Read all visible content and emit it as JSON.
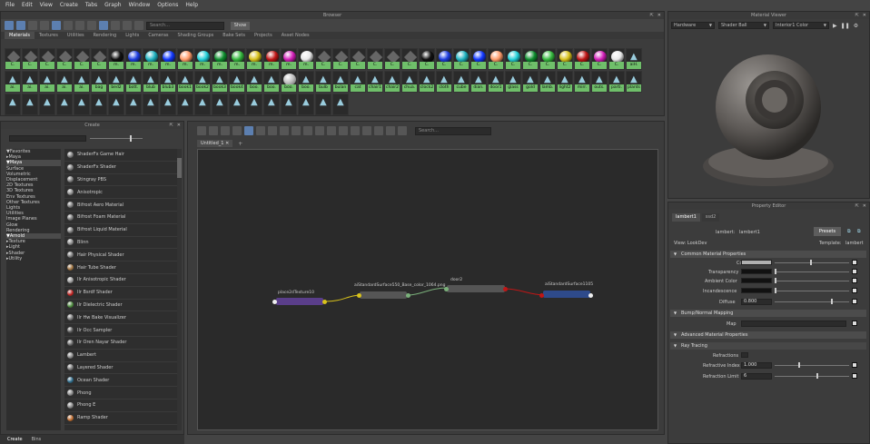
{
  "menubar": [
    "File",
    "Edit",
    "View",
    "Create",
    "Tabs",
    "Graph",
    "Window",
    "Options",
    "Help"
  ],
  "browser": {
    "title": "Browser",
    "search_placeholder": "Search...",
    "show_label": "Show",
    "tabs": [
      "Materials",
      "Textures",
      "Utilities",
      "Rendering",
      "Lights",
      "Cameras",
      "Shading Groups",
      "Bake Sets",
      "Projects",
      "Asset Nodes"
    ],
    "row1": [
      {
        "l": "C.",
        "c": "#777",
        "k": "d"
      },
      {
        "l": "C.",
        "c": "#777",
        "k": "d"
      },
      {
        "l": "C.",
        "c": "#777",
        "k": "d"
      },
      {
        "l": "C.",
        "c": "#777",
        "k": "d"
      },
      {
        "l": "C.",
        "c": "#777",
        "k": "d"
      },
      {
        "l": "C.",
        "c": "#777",
        "k": "d"
      },
      {
        "l": "m.",
        "c": "#111"
      },
      {
        "l": "m.",
        "c": "#1e3ee0"
      },
      {
        "l": "m.",
        "c": "#1fb2c0"
      },
      {
        "l": "m.",
        "c": "#1238ff"
      },
      {
        "l": "m.",
        "c": "#ff9b6a"
      },
      {
        "l": "m.",
        "c": "#23d0d8"
      },
      {
        "l": "m.",
        "c": "#0f8f2f"
      },
      {
        "l": "m.",
        "c": "#35b83e"
      },
      {
        "l": "m.",
        "c": "#d8c21b"
      },
      {
        "l": "m.",
        "c": "#c01616"
      },
      {
        "l": "m.",
        "c": "#d21fb8"
      },
      {
        "l": "m.",
        "c": "#e8e8e8"
      },
      {
        "l": "C.",
        "c": "#777",
        "k": "d"
      },
      {
        "l": "C.",
        "c": "#777",
        "k": "d"
      },
      {
        "l": "C.",
        "c": "#777",
        "k": "d"
      },
      {
        "l": "C.",
        "c": "#777",
        "k": "d"
      },
      {
        "l": "C.",
        "c": "#777",
        "k": "d"
      },
      {
        "l": "C.",
        "c": "#777",
        "k": "d"
      },
      {
        "l": "C.",
        "c": "#111"
      },
      {
        "l": "C.",
        "c": "#1e3ee0"
      },
      {
        "l": "C.",
        "c": "#1fb2c0"
      },
      {
        "l": "C.",
        "c": "#1238ff"
      },
      {
        "l": "C.",
        "c": "#ff9b6a"
      },
      {
        "l": "C.",
        "c": "#23d0d8"
      },
      {
        "l": "C.",
        "c": "#0f8f2f"
      },
      {
        "l": "C.",
        "c": "#35b83e"
      },
      {
        "l": "C.",
        "c": "#d8c21b"
      },
      {
        "l": "C.",
        "c": "#c01616"
      },
      {
        "l": "C.",
        "c": "#d21fb8"
      },
      {
        "l": "C.",
        "c": "#e8e8e8"
      },
      {
        "l": "aiH.",
        "c": "#2a4a5a",
        "k": "t"
      }
    ],
    "row2": [
      "ai.",
      "ai.",
      "ai.",
      "ai.",
      "ai.",
      "bag",
      "bed2",
      "bott.",
      "blub",
      "blub3",
      "book1",
      "book2",
      "book3",
      "book4",
      "boo.",
      "boo.",
      "boo.",
      "boo.",
      "bulb",
      "bulan",
      "cat",
      "chair1",
      "chair2",
      "chua.",
      "clock2",
      "cloth",
      "cube",
      "dian.",
      "door1",
      "glass",
      "gold",
      "lamb.",
      "light2",
      "mirr.",
      "outs.",
      "parti.",
      "plants"
    ],
    "row3": [
      "",
      "",
      "",
      "",
      "",
      "",
      "",
      "",
      "",
      "",
      "",
      "",
      "",
      "",
      "",
      "",
      "",
      "",
      "",
      ""
    ]
  },
  "create": {
    "title": "Create",
    "tree": [
      {
        "t": "▼Favorites",
        "s": false
      },
      {
        "t": "  ▸Maya",
        "s": false
      },
      {
        "t": "▼Maya",
        "s": true
      },
      {
        "t": "    Surface",
        "s": false
      },
      {
        "t": "    Volumetric",
        "s": false
      },
      {
        "t": "    Displacement",
        "s": false
      },
      {
        "t": "    2D Textures",
        "s": false
      },
      {
        "t": "    3D Textures",
        "s": false
      },
      {
        "t": "    Env Textures",
        "s": false
      },
      {
        "t": "    Other Textures",
        "s": false
      },
      {
        "t": "    Lights",
        "s": false
      },
      {
        "t": "    Utilities",
        "s": false
      },
      {
        "t": "    Image Planes",
        "s": false
      },
      {
        "t": "    Glow",
        "s": false
      },
      {
        "t": "    Rendering",
        "s": false
      },
      {
        "t": "▼Arnold",
        "s": true
      },
      {
        "t": "  ▸Texture",
        "s": false
      },
      {
        "t": "  ▸Light",
        "s": false
      },
      {
        "t": "  ▸Shader",
        "s": false
      },
      {
        "t": "  ▸Utility",
        "s": false
      }
    ],
    "nodes": [
      {
        "t": "ShaderFx Game Hair",
        "c": "#777"
      },
      {
        "t": "ShaderFx Shader",
        "c": "#777"
      },
      {
        "t": "Stingray PBS",
        "c": "#777"
      },
      {
        "t": "Anisotropic",
        "c": "#888"
      },
      {
        "t": "Bifrost Aero Material",
        "c": "#777"
      },
      {
        "t": "Bifrost Foam Material",
        "c": "#777"
      },
      {
        "t": "Bifrost Liquid Material",
        "c": "#777"
      },
      {
        "t": "Blinn",
        "c": "#888"
      },
      {
        "t": "Hair Physical Shader",
        "c": "#777"
      },
      {
        "t": "Hair Tube Shader",
        "c": "#a0723c"
      },
      {
        "t": "Ilr Anisotropic Shader",
        "c": "#999"
      },
      {
        "t": "Ilr Bsrdf Shader",
        "c": "#c0201e"
      },
      {
        "t": "Ilr Dielectric Shader",
        "c": "#4a8a3a"
      },
      {
        "t": "Ilr Hw Bake Visualizer",
        "c": "#777"
      },
      {
        "t": "Ilr Occ Sampler",
        "c": "#555"
      },
      {
        "t": "Ilr Oren Nayar Shader",
        "c": "#666"
      },
      {
        "t": "Lambert",
        "c": "#888"
      },
      {
        "t": "Layered Shader",
        "c": "#777"
      },
      {
        "t": "Ocean Shader",
        "c": "#2a6a8a"
      },
      {
        "t": "Phong",
        "c": "#888"
      },
      {
        "t": "Phong E",
        "c": "#888"
      },
      {
        "t": "Ramp Shader",
        "c": "#c06a2a"
      }
    ],
    "bottom_tabs": [
      "Create",
      "Bins"
    ]
  },
  "nodeeditor": {
    "search_placeholder": "Search...",
    "tab": "Untitled_1",
    "tab_close": "✕",
    "plus": "+",
    "nodes": {
      "n1": "place2dTexture10",
      "n2": "aiStandardSurface550_Base_color_1064.png",
      "n3": "door2",
      "n4": "aiStandardSurface1105"
    }
  },
  "matviewer": {
    "title": "Material Viewer",
    "renderer": "Hardware",
    "shape": "Shader Ball",
    "env": "Interior1 Color"
  },
  "propeditor": {
    "title": "Property Editor",
    "tabs": [
      "lambert1",
      "ssd2"
    ],
    "type_label": "lambert:",
    "name": "lambert1",
    "presets": "Presets",
    "view_label": "View: LookDev",
    "template_label": "Template:",
    "template": "lambert",
    "sections": {
      "common": "Common Material Properties",
      "bump": "Bump/Normal Mapping",
      "adv": "Advanced Material Properties",
      "ray": "Ray Tracing"
    },
    "labels": {
      "color": "Color",
      "transparency": "Transparency",
      "ambient": "Ambient Color",
      "incandescence": "Incandescence",
      "diffuse": "Diffuse",
      "map": "Map",
      "refractions": "Refractions",
      "refractive_index": "Refractive Index",
      "refraction_limit": "Refraction Limit"
    },
    "values": {
      "diffuse": "0.800",
      "refractive_index": "1.000",
      "refraction_limit": "6"
    }
  },
  "colors": {
    "accent": "#5c7fb0",
    "label_green": "#6fbf6a"
  }
}
